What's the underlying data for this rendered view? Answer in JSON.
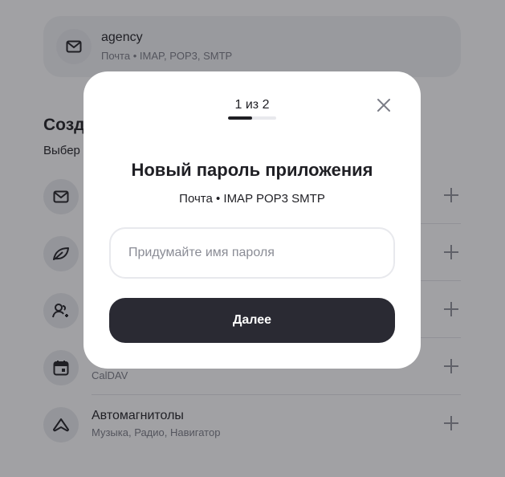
{
  "background": {
    "existing_password": {
      "name": "agency",
      "subtitle": "Почта • IMAP, POP3, SMTP",
      "icon": "mail-icon"
    },
    "section": {
      "title": "Созда",
      "subtitle": "Выбер"
    },
    "rows": [
      {
        "icon": "mail-icon",
        "title": "",
        "subtitle": ""
      },
      {
        "icon": "leaf-icon",
        "title": "",
        "subtitle": ""
      },
      {
        "icon": "contacts-icon",
        "title": "",
        "subtitle": ""
      },
      {
        "icon": "calendar-icon",
        "title": "",
        "subtitle": "CalDAV"
      },
      {
        "icon": "car-audio-icon",
        "title": "Автомагнитолы",
        "subtitle": "Музыка, Радио, Навигатор"
      }
    ]
  },
  "modal": {
    "step_label": "1 из 2",
    "progress": 0.5,
    "title": "Новый пароль приложения",
    "subtitle": "Почта • IMAP POP3 SMTP",
    "input": {
      "value": "",
      "placeholder": "Придумайте имя пароля"
    },
    "next_label": "Далее"
  },
  "colors": {
    "primary_button": "#2a2a33",
    "overlay": "#1e1f26"
  }
}
